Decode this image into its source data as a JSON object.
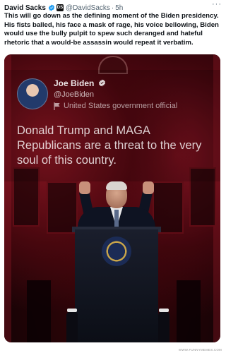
{
  "post": {
    "author_name": "David Sacks",
    "author_handle": "@DavidSacks",
    "separator": "·",
    "time": "5h",
    "more_label": "···",
    "affiliate_badge": "DS",
    "text": "This will go down as the defining moment of the Biden presidency. His fists balled, his face a mask of rage, his voice bellowing, Biden would use the bully pulpit to spew such deranged and hateful rhetoric that a would-be assassin would repeat it verbatim."
  },
  "quoted": {
    "name": "Joe Biden",
    "handle": "@JoeBiden",
    "label": "United States government official",
    "text": "Donald Trump and MAGA Republicans are a threat to the very soul of this country."
  },
  "icons": {
    "verified": "verified-badge-icon",
    "affiliate": "affiliate-badge-icon",
    "flag": "flag-icon",
    "more": "more-options-icon"
  },
  "colors": {
    "verified_blue": "#1d9bf0",
    "background_red": "#8a1522",
    "text_dark": "#0f1419",
    "text_muted": "#536471"
  },
  "watermark": "WWW.FUNNYMEMES.COM"
}
